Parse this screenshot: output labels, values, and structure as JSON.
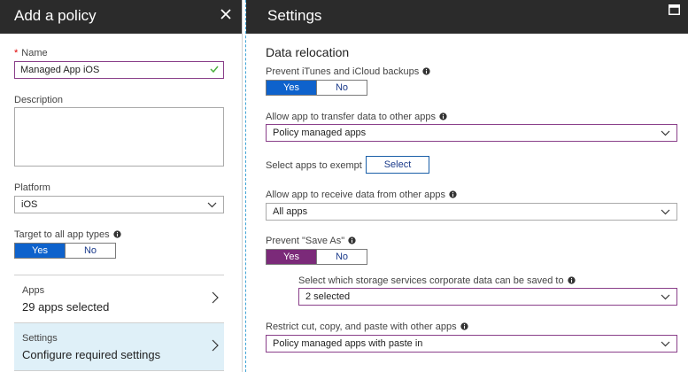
{
  "left_blade": {
    "title": "Add a policy",
    "name_label": "Name",
    "name_value": "Managed App iOS",
    "description_label": "Description",
    "platform_label": "Platform",
    "platform_value": "iOS",
    "target_label": "Target to all app types",
    "target_yes": "Yes",
    "target_no": "No",
    "apps_label": "Apps",
    "apps_value": "29 apps selected",
    "settings_label": "Settings",
    "settings_value": "Configure required settings"
  },
  "right_blade": {
    "title": "Settings",
    "section": "Data relocation",
    "prevent_backup_label": "Prevent iTunes and iCloud backups",
    "prevent_backup_yes": "Yes",
    "prevent_backup_no": "No",
    "transfer_label": "Allow app to transfer data to other apps",
    "transfer_value": "Policy managed apps",
    "exempt_label": "Select apps to exempt",
    "exempt_button": "Select",
    "receive_label": "Allow app to receive data from other apps",
    "receive_value": "All apps",
    "save_as_label": "Prevent \"Save As\"",
    "save_as_yes": "Yes",
    "save_as_no": "No",
    "storage_label": "Select which storage services corporate data can be saved to",
    "storage_value": "2 selected",
    "clipboard_label": "Restrict cut, copy, and paste with other apps",
    "clipboard_value": "Policy managed apps with paste in"
  },
  "colors": {
    "header_bg": "#2b2b2b",
    "toggle_blue": "#0e62cc",
    "toggle_purple": "#7b2a79",
    "accent_border": "#8a3f8a",
    "active_nav_bg": "#dff0f8"
  }
}
